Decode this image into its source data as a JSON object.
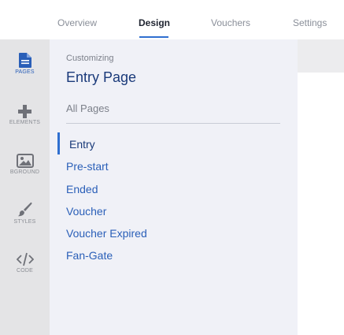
{
  "tabs": [
    {
      "label": "Overview"
    },
    {
      "label": "Design"
    },
    {
      "label": "Vouchers"
    },
    {
      "label": "Settings"
    }
  ],
  "rail": [
    {
      "label": "PAGES",
      "icon": "document-icon"
    },
    {
      "label": "ELEMENTS",
      "icon": "plus-icon"
    },
    {
      "label": "BGROUND",
      "icon": "image-icon"
    },
    {
      "label": "STYLES",
      "icon": "brush-icon"
    },
    {
      "label": "CODE",
      "icon": "code-icon"
    }
  ],
  "panel": {
    "subtitle": "Customizing",
    "title": "Entry Page",
    "all_pages": "All Pages",
    "pages": [
      {
        "label": "Entry"
      },
      {
        "label": "Pre-start"
      },
      {
        "label": "Ended"
      },
      {
        "label": "Voucher"
      },
      {
        "label": "Voucher Expired"
      },
      {
        "label": "Fan-Gate"
      }
    ]
  },
  "colors": {
    "accent": "#2f6fd0",
    "link": "#2a5fb8",
    "title": "#1a3a7a",
    "rail_bg": "#e4e4e6",
    "panel_bg": "#f0f1f7"
  }
}
